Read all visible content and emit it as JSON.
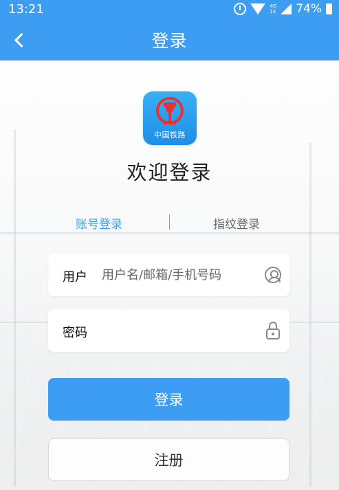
{
  "status_bar": {
    "time": "13:21",
    "network_top": "4G",
    "network_bottom": "1X",
    "battery": "74%"
  },
  "header": {
    "title": "登录",
    "back_icon": "chevron-left-icon"
  },
  "logo": {
    "text": "中国铁路",
    "icon": "china-railway-logo"
  },
  "welcome_text": "欢迎登录",
  "tabs": [
    {
      "label": "账号登录",
      "active": true
    },
    {
      "label": "指纹登录",
      "active": false
    }
  ],
  "form": {
    "user_label": "用户",
    "user_placeholder": "用户名/邮箱/手机号码",
    "user_value": "",
    "password_label": "密码",
    "password_placeholder": "",
    "password_value": ""
  },
  "buttons": {
    "login": "登录",
    "register": "注册"
  },
  "colors": {
    "accent": "#3d9df2",
    "logo_red": "#e8322f"
  }
}
